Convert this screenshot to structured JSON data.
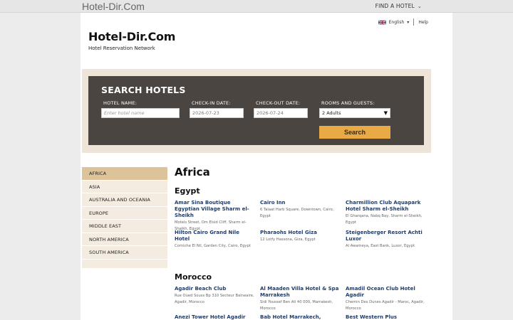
{
  "topbar": {
    "brand": "Hotel-Dir.Com",
    "find_hotel": "FIND A HOTEL"
  },
  "lang": {
    "label": "English",
    "help": "Help"
  },
  "logo": {
    "title": "Hotel-Dir.Com",
    "subtitle": "Hotel Reservation Network"
  },
  "search": {
    "heading": "SEARCH HOTELS",
    "hotel_name_label": "HOTEL NAME:",
    "hotel_name_placeholder": "Enter hotel name",
    "checkin_label": "CHECK-IN DATE:",
    "checkin_value": "2026-07-23",
    "checkout_label": "CHECK-OUT DATE:",
    "checkout_value": "2026-07-24",
    "rooms_label": "ROOMS AND GUESTS:",
    "rooms_value": "2 Adults",
    "button": "Search"
  },
  "sidebar": {
    "items": [
      {
        "label": "AFRICA"
      },
      {
        "label": "ASIA"
      },
      {
        "label": "AUSTRALIA AND OCEANIA"
      },
      {
        "label": "EUROPE"
      },
      {
        "label": "MIDDLE EAST"
      },
      {
        "label": "NORTH AMERICA"
      },
      {
        "label": "SOUTH AMERICA"
      }
    ]
  },
  "content": {
    "region": "Africa",
    "countries": [
      {
        "name": "Egypt",
        "hotels": [
          {
            "name": "Amar Sina Boutique Egyptian Village Sharm el-Sheikh",
            "address": "Motels Street, Om Elsid Cliff, Sharm el-Sheikh, Egypt"
          },
          {
            "name": "Cairo Inn",
            "address": "6 Talaat Harb Square, Downtown, Cairo, Egypt"
          },
          {
            "name": "Charmillion Club Aquapark Hotel Sharm el-Sheikh",
            "address": "El Gharqana, Nabq Bay, Sharm el-Sheikh, Egypt"
          },
          {
            "name": "Hilton Cairo Grand Nile Hotel",
            "address": "Corniche El Nil, Garden City, Cairo, Egypt"
          },
          {
            "name": "Pharaohs Hotel Giza",
            "address": "12 Lotfy Hassona, Giza, Egypt"
          },
          {
            "name": "Steigenberger Resort Achti Luxor",
            "address": "Al Awameya, East Bank, Luxor, Egypt"
          }
        ]
      },
      {
        "name": "Morocco",
        "hotels": [
          {
            "name": "Agadir Beach Club",
            "address": "Rue Oued Souss Bp 310 Secteur Balneaire, Agadir, Morocco"
          },
          {
            "name": "Al Maaden Villa Hotel & Spa Marrakesh",
            "address": "Sidi Youssef Ben Ali 40 000, Marrakesh, Morocco"
          },
          {
            "name": "Amadil Ocean Club Hotel Agadir",
            "address": "Chemin Des Dunes Agadir - Maroc, Agadir, Morocco"
          },
          {
            "name": "Anezi Tower Hotel Agadir",
            "address": ""
          },
          {
            "name": "Bab Hotel Marrakech, Boutique",
            "address": ""
          },
          {
            "name": "Best Western Plus Casablanca",
            "address": ""
          }
        ]
      }
    ]
  },
  "colors": {
    "accent": "#e9a944",
    "panel": "#4a4540",
    "link": "#1f3d6e",
    "sidebar_active": "#dcc39a"
  },
  "icons": {
    "flag": "uk-flag-icon",
    "chevron": "chevron-down-icon"
  }
}
